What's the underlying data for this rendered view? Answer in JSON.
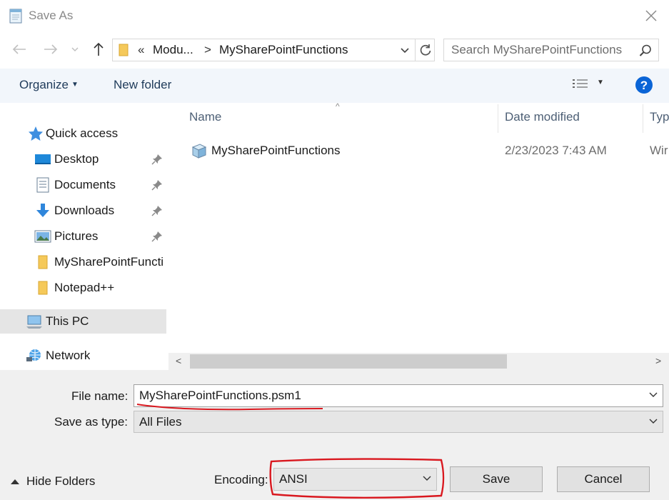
{
  "window": {
    "title": "Save As",
    "close_icon": "close-icon"
  },
  "navigation": {
    "back_icon": "arrow-left-icon",
    "forward_icon": "arrow-right-icon",
    "recent_icon": "chevron-down-icon",
    "up_icon": "arrow-up-icon",
    "address": {
      "overflow": "«",
      "crumbs": [
        "Modu...",
        "MySharePointFunctions"
      ],
      "separator": ">"
    },
    "search": {
      "placeholder": "Search MySharePointFunctions"
    }
  },
  "toolbar": {
    "organize_label": "Organize",
    "new_folder_label": "New folder",
    "views_icon": "view-details-icon",
    "help_icon": "help-icon"
  },
  "sidebar": {
    "items": [
      {
        "label": "Quick access",
        "icon": "star-icon"
      },
      {
        "label": "Desktop",
        "icon": "desktop-icon",
        "pinned": true
      },
      {
        "label": "Documents",
        "icon": "documents-icon",
        "pinned": true
      },
      {
        "label": "Downloads",
        "icon": "download-icon",
        "pinned": true
      },
      {
        "label": "Pictures",
        "icon": "pictures-icon",
        "pinned": true
      },
      {
        "label": "MySharePointFuncti",
        "icon": "folder-icon"
      },
      {
        "label": "Notepad++",
        "icon": "folder-icon"
      },
      {
        "label": "This PC",
        "icon": "computer-icon"
      },
      {
        "label": "Network",
        "icon": "network-icon"
      }
    ]
  },
  "filelist": {
    "columns": {
      "name": "Name",
      "date": "Date modified",
      "type": "Typ"
    },
    "rows": [
      {
        "name": "MySharePointFunctions",
        "date": "2/23/2023 7:43 AM",
        "type": "Wir"
      }
    ]
  },
  "form": {
    "file_name_label": "File name:",
    "file_name_value": "MySharePointFunctions.psm1",
    "save_type_label": "Save as type:",
    "save_type_value": "All Files",
    "encoding_label": "Encoding:",
    "encoding_value": "ANSI",
    "save_label": "Save",
    "cancel_label": "Cancel",
    "hide_folders_label": "Hide Folders"
  },
  "annotation_color": "#d9181f"
}
